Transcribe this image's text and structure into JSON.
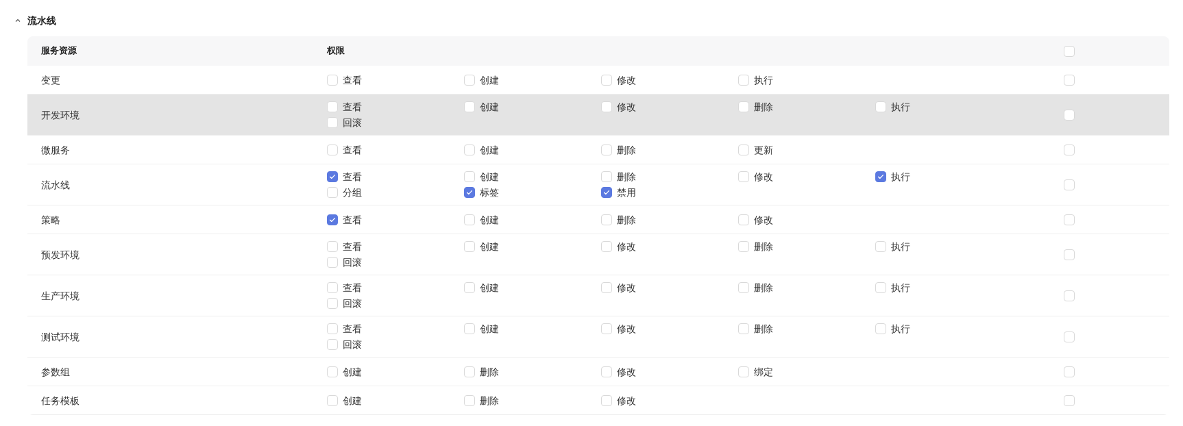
{
  "section": {
    "title": "流水线",
    "expanded": true
  },
  "table": {
    "columns": [
      "服务资源",
      "权限"
    ],
    "header_checked": false,
    "rows": [
      {
        "resource": "变更",
        "highlighted": false,
        "row_checked": false,
        "permissions": [
          {
            "label": "查看",
            "checked": false
          },
          {
            "label": "创建",
            "checked": false
          },
          {
            "label": "修改",
            "checked": false
          },
          {
            "label": "执行",
            "checked": false
          }
        ]
      },
      {
        "resource": "开发环境",
        "highlighted": true,
        "row_checked": false,
        "permissions": [
          {
            "label": "查看",
            "checked": false
          },
          {
            "label": "创建",
            "checked": false
          },
          {
            "label": "修改",
            "checked": false
          },
          {
            "label": "删除",
            "checked": false
          },
          {
            "label": "执行",
            "checked": false
          },
          {
            "label": "回滚",
            "checked": false
          }
        ]
      },
      {
        "resource": "微服务",
        "highlighted": false,
        "row_checked": false,
        "permissions": [
          {
            "label": "查看",
            "checked": false
          },
          {
            "label": "创建",
            "checked": false
          },
          {
            "label": "删除",
            "checked": false
          },
          {
            "label": "更新",
            "checked": false
          }
        ]
      },
      {
        "resource": "流水线",
        "highlighted": false,
        "row_checked": false,
        "permissions": [
          {
            "label": "查看",
            "checked": true
          },
          {
            "label": "创建",
            "checked": false
          },
          {
            "label": "删除",
            "checked": false
          },
          {
            "label": "修改",
            "checked": false
          },
          {
            "label": "执行",
            "checked": true
          },
          {
            "label": "分组",
            "checked": false
          },
          {
            "label": "标签",
            "checked": true
          },
          {
            "label": "禁用",
            "checked": true
          }
        ]
      },
      {
        "resource": "策略",
        "highlighted": false,
        "row_checked": false,
        "permissions": [
          {
            "label": "查看",
            "checked": true
          },
          {
            "label": "创建",
            "checked": false
          },
          {
            "label": "删除",
            "checked": false
          },
          {
            "label": "修改",
            "checked": false
          }
        ]
      },
      {
        "resource": "预发环境",
        "highlighted": false,
        "row_checked": false,
        "permissions": [
          {
            "label": "查看",
            "checked": false
          },
          {
            "label": "创建",
            "checked": false
          },
          {
            "label": "修改",
            "checked": false
          },
          {
            "label": "删除",
            "checked": false
          },
          {
            "label": "执行",
            "checked": false
          },
          {
            "label": "回滚",
            "checked": false
          }
        ]
      },
      {
        "resource": "生产环境",
        "highlighted": false,
        "row_checked": false,
        "permissions": [
          {
            "label": "查看",
            "checked": false
          },
          {
            "label": "创建",
            "checked": false
          },
          {
            "label": "修改",
            "checked": false
          },
          {
            "label": "删除",
            "checked": false
          },
          {
            "label": "执行",
            "checked": false
          },
          {
            "label": "回滚",
            "checked": false
          }
        ]
      },
      {
        "resource": "测试环境",
        "highlighted": false,
        "row_checked": false,
        "permissions": [
          {
            "label": "查看",
            "checked": false
          },
          {
            "label": "创建",
            "checked": false
          },
          {
            "label": "修改",
            "checked": false
          },
          {
            "label": "删除",
            "checked": false
          },
          {
            "label": "执行",
            "checked": false
          },
          {
            "label": "回滚",
            "checked": false
          }
        ]
      },
      {
        "resource": "参数组",
        "highlighted": false,
        "row_checked": false,
        "permissions": [
          {
            "label": "创建",
            "checked": false
          },
          {
            "label": "删除",
            "checked": false
          },
          {
            "label": "修改",
            "checked": false
          },
          {
            "label": "绑定",
            "checked": false
          }
        ]
      },
      {
        "resource": "任务模板",
        "highlighted": false,
        "row_checked": false,
        "permissions": [
          {
            "label": "创建",
            "checked": false
          },
          {
            "label": "删除",
            "checked": false
          },
          {
            "label": "修改",
            "checked": false
          }
        ]
      }
    ]
  }
}
